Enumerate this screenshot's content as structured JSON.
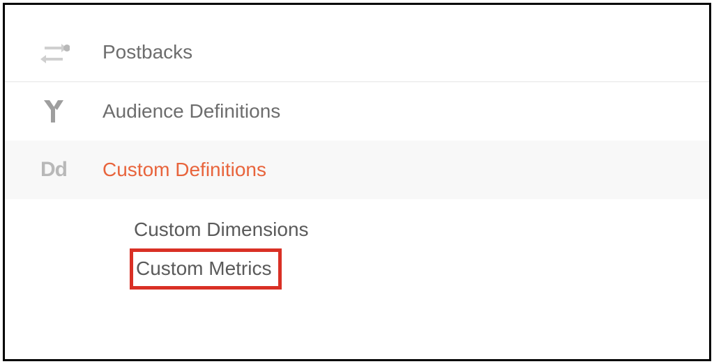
{
  "nav": {
    "items": [
      {
        "label": "Postbacks",
        "icon": "swap"
      },
      {
        "label": "Audience Definitions",
        "icon": "fork"
      },
      {
        "label": "Custom Definitions",
        "icon": "Dd",
        "active": true
      }
    ]
  },
  "subnav": {
    "items": [
      {
        "label": "Custom Dimensions",
        "highlighted": false
      },
      {
        "label": "Custom Metrics",
        "highlighted": true
      }
    ]
  }
}
